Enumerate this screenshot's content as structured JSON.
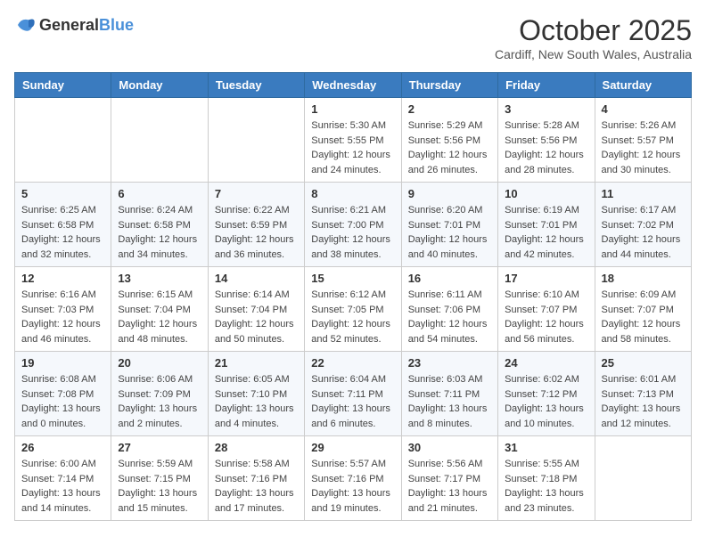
{
  "logo": {
    "text_general": "General",
    "text_blue": "Blue"
  },
  "header": {
    "month": "October 2025",
    "location": "Cardiff, New South Wales, Australia"
  },
  "weekdays": [
    "Sunday",
    "Monday",
    "Tuesday",
    "Wednesday",
    "Thursday",
    "Friday",
    "Saturday"
  ],
  "weeks": [
    [
      {
        "day": "",
        "sunrise": "",
        "sunset": "",
        "daylight": ""
      },
      {
        "day": "",
        "sunrise": "",
        "sunset": "",
        "daylight": ""
      },
      {
        "day": "",
        "sunrise": "",
        "sunset": "",
        "daylight": ""
      },
      {
        "day": "1",
        "sunrise": "Sunrise: 5:30 AM",
        "sunset": "Sunset: 5:55 PM",
        "daylight": "Daylight: 12 hours and 24 minutes."
      },
      {
        "day": "2",
        "sunrise": "Sunrise: 5:29 AM",
        "sunset": "Sunset: 5:56 PM",
        "daylight": "Daylight: 12 hours and 26 minutes."
      },
      {
        "day": "3",
        "sunrise": "Sunrise: 5:28 AM",
        "sunset": "Sunset: 5:56 PM",
        "daylight": "Daylight: 12 hours and 28 minutes."
      },
      {
        "day": "4",
        "sunrise": "Sunrise: 5:26 AM",
        "sunset": "Sunset: 5:57 PM",
        "daylight": "Daylight: 12 hours and 30 minutes."
      }
    ],
    [
      {
        "day": "5",
        "sunrise": "Sunrise: 6:25 AM",
        "sunset": "Sunset: 6:58 PM",
        "daylight": "Daylight: 12 hours and 32 minutes."
      },
      {
        "day": "6",
        "sunrise": "Sunrise: 6:24 AM",
        "sunset": "Sunset: 6:58 PM",
        "daylight": "Daylight: 12 hours and 34 minutes."
      },
      {
        "day": "7",
        "sunrise": "Sunrise: 6:22 AM",
        "sunset": "Sunset: 6:59 PM",
        "daylight": "Daylight: 12 hours and 36 minutes."
      },
      {
        "day": "8",
        "sunrise": "Sunrise: 6:21 AM",
        "sunset": "Sunset: 7:00 PM",
        "daylight": "Daylight: 12 hours and 38 minutes."
      },
      {
        "day": "9",
        "sunrise": "Sunrise: 6:20 AM",
        "sunset": "Sunset: 7:01 PM",
        "daylight": "Daylight: 12 hours and 40 minutes."
      },
      {
        "day": "10",
        "sunrise": "Sunrise: 6:19 AM",
        "sunset": "Sunset: 7:01 PM",
        "daylight": "Daylight: 12 hours and 42 minutes."
      },
      {
        "day": "11",
        "sunrise": "Sunrise: 6:17 AM",
        "sunset": "Sunset: 7:02 PM",
        "daylight": "Daylight: 12 hours and 44 minutes."
      }
    ],
    [
      {
        "day": "12",
        "sunrise": "Sunrise: 6:16 AM",
        "sunset": "Sunset: 7:03 PM",
        "daylight": "Daylight: 12 hours and 46 minutes."
      },
      {
        "day": "13",
        "sunrise": "Sunrise: 6:15 AM",
        "sunset": "Sunset: 7:04 PM",
        "daylight": "Daylight: 12 hours and 48 minutes."
      },
      {
        "day": "14",
        "sunrise": "Sunrise: 6:14 AM",
        "sunset": "Sunset: 7:04 PM",
        "daylight": "Daylight: 12 hours and 50 minutes."
      },
      {
        "day": "15",
        "sunrise": "Sunrise: 6:12 AM",
        "sunset": "Sunset: 7:05 PM",
        "daylight": "Daylight: 12 hours and 52 minutes."
      },
      {
        "day": "16",
        "sunrise": "Sunrise: 6:11 AM",
        "sunset": "Sunset: 7:06 PM",
        "daylight": "Daylight: 12 hours and 54 minutes."
      },
      {
        "day": "17",
        "sunrise": "Sunrise: 6:10 AM",
        "sunset": "Sunset: 7:07 PM",
        "daylight": "Daylight: 12 hours and 56 minutes."
      },
      {
        "day": "18",
        "sunrise": "Sunrise: 6:09 AM",
        "sunset": "Sunset: 7:07 PM",
        "daylight": "Daylight: 12 hours and 58 minutes."
      }
    ],
    [
      {
        "day": "19",
        "sunrise": "Sunrise: 6:08 AM",
        "sunset": "Sunset: 7:08 PM",
        "daylight": "Daylight: 13 hours and 0 minutes."
      },
      {
        "day": "20",
        "sunrise": "Sunrise: 6:06 AM",
        "sunset": "Sunset: 7:09 PM",
        "daylight": "Daylight: 13 hours and 2 minutes."
      },
      {
        "day": "21",
        "sunrise": "Sunrise: 6:05 AM",
        "sunset": "Sunset: 7:10 PM",
        "daylight": "Daylight: 13 hours and 4 minutes."
      },
      {
        "day": "22",
        "sunrise": "Sunrise: 6:04 AM",
        "sunset": "Sunset: 7:11 PM",
        "daylight": "Daylight: 13 hours and 6 minutes."
      },
      {
        "day": "23",
        "sunrise": "Sunrise: 6:03 AM",
        "sunset": "Sunset: 7:11 PM",
        "daylight": "Daylight: 13 hours and 8 minutes."
      },
      {
        "day": "24",
        "sunrise": "Sunrise: 6:02 AM",
        "sunset": "Sunset: 7:12 PM",
        "daylight": "Daylight: 13 hours and 10 minutes."
      },
      {
        "day": "25",
        "sunrise": "Sunrise: 6:01 AM",
        "sunset": "Sunset: 7:13 PM",
        "daylight": "Daylight: 13 hours and 12 minutes."
      }
    ],
    [
      {
        "day": "26",
        "sunrise": "Sunrise: 6:00 AM",
        "sunset": "Sunset: 7:14 PM",
        "daylight": "Daylight: 13 hours and 14 minutes."
      },
      {
        "day": "27",
        "sunrise": "Sunrise: 5:59 AM",
        "sunset": "Sunset: 7:15 PM",
        "daylight": "Daylight: 13 hours and 15 minutes."
      },
      {
        "day": "28",
        "sunrise": "Sunrise: 5:58 AM",
        "sunset": "Sunset: 7:16 PM",
        "daylight": "Daylight: 13 hours and 17 minutes."
      },
      {
        "day": "29",
        "sunrise": "Sunrise: 5:57 AM",
        "sunset": "Sunset: 7:16 PM",
        "daylight": "Daylight: 13 hours and 19 minutes."
      },
      {
        "day": "30",
        "sunrise": "Sunrise: 5:56 AM",
        "sunset": "Sunset: 7:17 PM",
        "daylight": "Daylight: 13 hours and 21 minutes."
      },
      {
        "day": "31",
        "sunrise": "Sunrise: 5:55 AM",
        "sunset": "Sunset: 7:18 PM",
        "daylight": "Daylight: 13 hours and 23 minutes."
      },
      {
        "day": "",
        "sunrise": "",
        "sunset": "",
        "daylight": ""
      }
    ]
  ]
}
